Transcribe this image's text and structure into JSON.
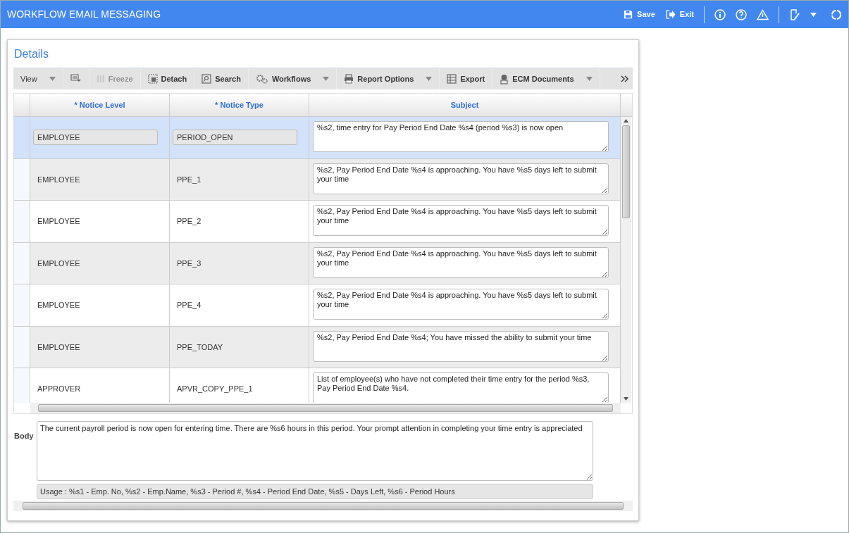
{
  "window": {
    "title": "WORKFLOW EMAIL MESSAGING"
  },
  "header_actions": [
    {
      "label": "Save"
    },
    {
      "label": "Exit"
    }
  ],
  "panel": {
    "title": "Details"
  },
  "toolbar": [
    {
      "label": "View",
      "disabled": false,
      "dropdown": true
    },
    {
      "disabled": false,
      "dropdown": false
    },
    {
      "label": "Freeze",
      "disabled": true,
      "dropdown": false
    },
    {
      "label": "Detach",
      "disabled": false,
      "dropdown": false
    },
    {
      "label": "Search",
      "disabled": false,
      "dropdown": false
    },
    {
      "label": "Workflows",
      "disabled": false,
      "dropdown": true
    },
    {
      "label": "Report Options",
      "disabled": false,
      "dropdown": true
    },
    {
      "label": "Export",
      "disabled": false,
      "dropdown": false
    },
    {
      "label": "ECM Documents",
      "disabled": false,
      "dropdown": true
    }
  ],
  "table": {
    "columns": [
      "* Notice Level",
      "* Notice Type",
      "Subject"
    ],
    "rows": [
      {
        "selected": true,
        "notice_level": "EMPLOYEE",
        "notice_type": "PERIOD_OPEN",
        "subject": "%s2, time entry for Pay Period End Date %s4 (period %s3) is now open"
      },
      {
        "selected": false,
        "notice_level": "EMPLOYEE",
        "notice_type": "PPE_1",
        "subject": "%s2, Pay Period End Date %s4 is approaching. You have %s5 days left to submit your time"
      },
      {
        "selected": false,
        "notice_level": "EMPLOYEE",
        "notice_type": "PPE_2",
        "subject": "%s2, Pay Period End Date %s4 is approaching. You have %s5 days left to submit your time"
      },
      {
        "selected": false,
        "notice_level": "EMPLOYEE",
        "notice_type": "PPE_3",
        "subject": "%s2, Pay Period End Date %s4 is approaching. You have %s5 days left to submit your time"
      },
      {
        "selected": false,
        "notice_level": "EMPLOYEE",
        "notice_type": "PPE_4",
        "subject": "%s2, Pay Period End Date %s4 is approaching. You have %s5 days left to submit your time"
      },
      {
        "selected": false,
        "notice_level": "EMPLOYEE",
        "notice_type": "PPE_TODAY",
        "subject": "%s2, Pay Period End Date %s4; You have missed the ability to submit your time"
      },
      {
        "selected": false,
        "notice_level": "APPROVER",
        "notice_type": "APVR_COPY_PPE_1",
        "subject": "List of employee(s) who have not completed their time entry for the period %s3, Pay Period End Date %s4."
      }
    ]
  },
  "body": {
    "label": "Body",
    "value": "The current payroll period is now open for entering time. There are %s6 hours in this period. Your prompt attention in completing your time entry is appreciated",
    "usage": "Usage : %s1 - Emp. No, %s2 - Emp.Name, %s3 - Period #, %s4 - Period End Date, %s5 - Days Left, %s6 - Period Hours"
  }
}
